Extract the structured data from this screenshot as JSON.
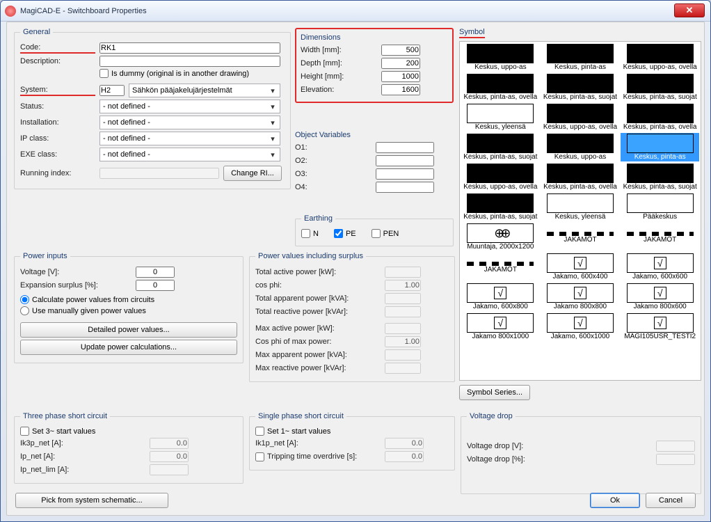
{
  "window": {
    "title": "MagiCAD-E - Switchboard Properties"
  },
  "general": {
    "legend": "General",
    "code_label": "Code:",
    "code_value": "RK1",
    "desc_label": "Description:",
    "desc_value": "",
    "dummy_label": "Is dummy (original is in another drawing)",
    "system_label": "System:",
    "system_code": "H2",
    "system_value": "Sähkön pääjakelujärjestelmät",
    "status_label": "Status:",
    "status_value": "- not defined -",
    "install_label": "Installation:",
    "install_value": "- not defined -",
    "ip_label": "IP class:",
    "ip_value": "- not defined -",
    "exe_label": "EXE class:",
    "exe_value": "- not defined -",
    "ri_label": "Running index:",
    "ri_btn": "Change RI..."
  },
  "dimensions": {
    "legend": "Dimensions",
    "width_label": "Width [mm]:",
    "width": "500",
    "depth_label": "Depth [mm]:",
    "depth": "200",
    "height_label": "Height [mm]:",
    "height": "1000",
    "elev_label": "Elevation:",
    "elev": "1600"
  },
  "ov": {
    "legend": "Object Variables",
    "o1": "O1:",
    "o2": "O2:",
    "o3": "O3:",
    "o4": "O4:"
  },
  "earthing": {
    "legend": "Earthing",
    "n": "N",
    "pe": "PE",
    "pen": "PEN"
  },
  "symbol": {
    "legend": "Symbol",
    "series_btn": "Symbol Series...",
    "items": [
      {
        "cap": "Keskus, uppo-as",
        "t": "black"
      },
      {
        "cap": "Keskus, pinta-as",
        "t": "black"
      },
      {
        "cap": "Keskus, uppo-as, ovella",
        "t": "black"
      },
      {
        "cap": "Keskus, pinta-as, ovella",
        "t": "black"
      },
      {
        "cap": "Keskus, pinta-as, suojat",
        "t": "black"
      },
      {
        "cap": "Keskus, pinta-as, suojat",
        "t": "black"
      },
      {
        "cap": "Keskus, yleensä",
        "t": "white"
      },
      {
        "cap": "Keskus, uppo-as, ovella",
        "t": "black"
      },
      {
        "cap": "Keskus, pinta-as, ovella",
        "t": "black"
      },
      {
        "cap": "Keskus, pinta-as, suojat",
        "t": "black"
      },
      {
        "cap": "Keskus, uppo-as",
        "t": "black"
      },
      {
        "cap": "Keskus, pinta-as",
        "t": "blue",
        "sel": true
      },
      {
        "cap": "Keskus, uppo-as, ovella",
        "t": "black"
      },
      {
        "cap": "Keskus, pinta-as, ovella",
        "t": "black"
      },
      {
        "cap": "Keskus, pinta-as, suojat",
        "t": "black"
      },
      {
        "cap": "Keskus, pinta-as, suojat",
        "t": "black"
      },
      {
        "cap": "Keskus, yleensä",
        "t": "white"
      },
      {
        "cap": "Pääkeskus",
        "t": "white"
      },
      {
        "cap": "Muuntaja, 2000x1200",
        "t": "circle"
      },
      {
        "cap": "JAKAMOT",
        "t": "dash"
      },
      {
        "cap": "JAKAMOT",
        "t": "dash"
      },
      {
        "cap": "JAKAMOT",
        "t": "dash"
      },
      {
        "cap": "Jakamo, 600x400",
        "t": "sq"
      },
      {
        "cap": "Jakamo, 600x600",
        "t": "sq"
      },
      {
        "cap": "Jakamo, 600x800",
        "t": "sq"
      },
      {
        "cap": "Jakamo 800x800",
        "t": "sq"
      },
      {
        "cap": "Jakamo 800x600",
        "t": "sq"
      },
      {
        "cap": "Jakamo 800x1000",
        "t": "sq"
      },
      {
        "cap": "Jakamo, 600x1000",
        "t": "sq"
      },
      {
        "cap": "MAGI105USR_TESTI2",
        "t": "sq"
      }
    ]
  },
  "pi": {
    "legend": "Power inputs",
    "voltage_label": "Voltage [V]:",
    "voltage": "0",
    "surplus_label": "Expansion surplus [%]:",
    "surplus": "0",
    "calc_label": "Calculate power values from circuits",
    "manual_label": "Use manually given power values",
    "detailed_btn": "Detailed power values...",
    "update_btn": "Update power calculations..."
  },
  "pv": {
    "legend": "Power values including surplus",
    "tap_label": "Total active power [kW]:",
    "cosphi_label": "cos phi:",
    "cosphi": "1.00",
    "tsp_label": "Total apparent power [kVA]:",
    "trp_label": "Total reactive power [kVAr]:",
    "map_label": "Max active power [kW]:",
    "cmp_label": "Cos phi of max power:",
    "cmp": "1.00",
    "msp_label": "Max apparent power [kVA]:",
    "mrp_label": "Max reactive power [kVAr]:"
  },
  "tp": {
    "legend": "Three phase short circuit",
    "set_label": "Set 3~ start values",
    "ik3p_label": "Ik3p_net [A]:",
    "ik3p": "0.0",
    "ipnet_label": "Ip_net [A]:",
    "ipnet": "0.0",
    "iplim_label": "Ip_net_lim [A]:",
    "iplim": ""
  },
  "sp": {
    "legend": "Single phase short circuit",
    "set_label": "Set 1~ start values",
    "ik1p_label": "Ik1p_net [A]:",
    "ik1p": "0.0",
    "trip_label": "Tripping time overdrive [s]:",
    "trip": "0.0"
  },
  "vd": {
    "legend": "Voltage drop",
    "v_label": "Voltage drop [V]:",
    "p_label": "Voltage drop [%]:"
  },
  "buttons": {
    "ok": "Ok",
    "cancel": "Cancel",
    "pick": "Pick from system schematic..."
  }
}
